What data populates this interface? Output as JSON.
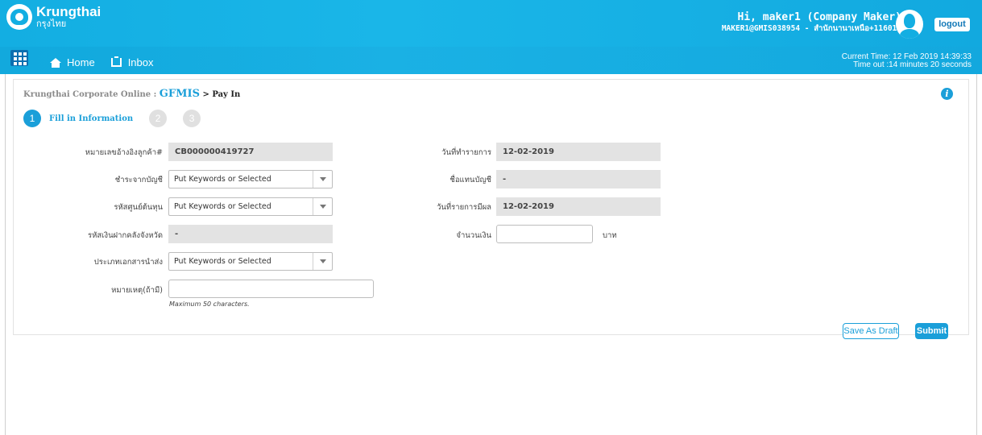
{
  "header": {
    "logo_name": "Krungthai",
    "logo_sub": "กรุงไทย",
    "greeting": "Hi, maker1 (Company Maker)",
    "user_sub": "MAKER1@GMIS038954 - สำนักนานาเหนือ+116017",
    "logout_label": "logout",
    "current_time": "Current Time: 12 Feb 2019 14:39:33",
    "timeout": "Time out :14 minutes 20 seconds"
  },
  "nav": {
    "home": "Home",
    "inbox": "Inbox"
  },
  "breadcrumb": {
    "root": "Krungthai Corporate Online : ",
    "mid": "GFMIS",
    "last": " > Pay In"
  },
  "steps": [
    {
      "num": "1",
      "label": "Fill in Information"
    },
    {
      "num": "2"
    },
    {
      "num": "3"
    }
  ],
  "form": {
    "customer_ref_label": "หมายเลขอ้างอิงลูกค้า#",
    "customer_ref_value": "CB000000419727",
    "pay_from_label": "ชำระจากบัญชี",
    "pay_from_value": "Put Keywords or Selected",
    "cost_center_label": "รหัสศูนย์ต้นทุน",
    "cost_center_value": "Put Keywords or Selected",
    "deposit_code_label": "รหัสเงินฝากคลังจังหวัด",
    "deposit_code_value": "-",
    "doc_type_label": "ประเภทเอกสารนำส่ง",
    "doc_type_value": "Put Keywords or Selected",
    "remark_label": "หมายเหตุ(ถ้ามี)",
    "remark_value": "",
    "remark_hint": "Maximum 50 characters.",
    "tx_date_label": "วันที่ทำรายการ",
    "tx_date_value": "12-02-2019",
    "account_name_label": "ชื่อแทนบัญชี",
    "account_name_value": "-",
    "effective_date_label": "วันที่รายการมีผล",
    "effective_date_value": "12-02-2019",
    "amount_label": "จำนวนเงิน",
    "amount_value": "",
    "amount_unit": "บาท"
  },
  "actions": {
    "save_draft": "Save As Draft",
    "submit": "Submit"
  },
  "colors": {
    "accent": "#1a9fd9",
    "header": "#13aee2"
  }
}
